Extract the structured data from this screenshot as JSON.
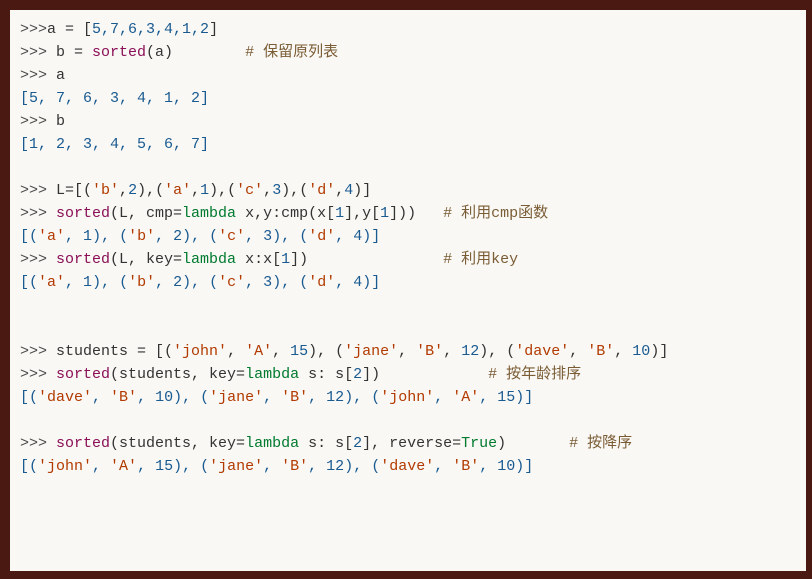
{
  "lines": {
    "l1": {
      "prompt": ">>>",
      "code1": "a = [",
      "nums": "5,7,6,3,4,1,2",
      "code2": "]"
    },
    "l2": {
      "prompt": ">>> ",
      "code1": "b = ",
      "fn": "sorted",
      "code2": "(a)        ",
      "comment": "# 保留原列表"
    },
    "l3": {
      "prompt": ">>> ",
      "code1": "a"
    },
    "l4": {
      "out": "[5, 7, 6, 3, 4, 1, 2]"
    },
    "l5": {
      "prompt": ">>> ",
      "code1": "b"
    },
    "l6": {
      "out": "[1, 2, 3, 4, 5, 6, 7]"
    },
    "l7": {
      "prompt": ">>> ",
      "code1": "L=[(",
      "s1": "'b'",
      "code2": ",",
      "n1": "2",
      "code3": "),(",
      "s2": "'a'",
      "code4": ",",
      "n2": "1",
      "code5": "),(",
      "s3": "'c'",
      "code6": ",",
      "n3": "3",
      "code7": "),(",
      "s4": "'d'",
      "code8": ",",
      "n4": "4",
      "code9": ")]"
    },
    "l8": {
      "prompt": ">>> ",
      "fn": "sorted",
      "code1": "(L, cmp=",
      "kw": "lambda",
      "code2": " x,y:cmp(x[",
      "n1": "1",
      "code3": "],y[",
      "n2": "1",
      "code4": "]))   ",
      "comment": "# 利用cmp函数"
    },
    "l9": {
      "out1": "[(",
      "s1": "'a'",
      "out2": ", ",
      "n1": "1",
      "out3": "), (",
      "s2": "'b'",
      "out4": ", ",
      "n2": "2",
      "out5": "), (",
      "s3": "'c'",
      "out6": ", ",
      "n3": "3",
      "out7": "), (",
      "s4": "'d'",
      "out8": ", ",
      "n4": "4",
      "out9": ")]"
    },
    "l10": {
      "prompt": ">>> ",
      "fn": "sorted",
      "code1": "(L, key=",
      "kw": "lambda",
      "code2": " x:x[",
      "n1": "1",
      "code3": "])               ",
      "comment": "# 利用key"
    },
    "l11": {
      "out1": "[(",
      "s1": "'a'",
      "out2": ", ",
      "n1": "1",
      "out3": "), (",
      "s2": "'b'",
      "out4": ", ",
      "n2": "2",
      "out5": "), (",
      "s3": "'c'",
      "out6": ", ",
      "n3": "3",
      "out7": "), (",
      "s4": "'d'",
      "out8": ", ",
      "n4": "4",
      "out9": ")]"
    },
    "l12": {
      "prompt": ">>> ",
      "code1": "students = [(",
      "s1": "'john'",
      "code2": ", ",
      "s2": "'A'",
      "code3": ", ",
      "n1": "15",
      "code4": "), (",
      "s3": "'jane'",
      "code5": ", ",
      "s4": "'B'",
      "code6": ", ",
      "n2": "12",
      "code7": "), (",
      "s5": "'dave'",
      "code8": ", ",
      "s6": "'B'",
      "code9": ", ",
      "n3": "10",
      "code10": ")]"
    },
    "l13": {
      "prompt": ">>> ",
      "fn": "sorted",
      "code1": "(students, key=",
      "kw": "lambda",
      "code2": " s: s[",
      "n1": "2",
      "code3": "])            ",
      "comment": "# 按年龄排序"
    },
    "l14": {
      "out1": "[(",
      "s1": "'dave'",
      "out2": ", ",
      "s2": "'B'",
      "out3": ", ",
      "n1": "10",
      "out4": "), (",
      "s3": "'jane'",
      "out5": ", ",
      "s4": "'B'",
      "out6": ", ",
      "n2": "12",
      "out7": "), (",
      "s5": "'john'",
      "out8": ", ",
      "s6": "'A'",
      "out9": ", ",
      "n3": "15",
      "out10": ")]"
    },
    "l15": {
      "prompt": ">>> ",
      "fn": "sorted",
      "code1": "(students, key=",
      "kw": "lambda",
      "code2": " s: s[",
      "n1": "2",
      "code3": "], reverse=",
      "kw2": "True",
      "code4": ")       ",
      "comment": "# 按降序"
    },
    "l16": {
      "out1": "[(",
      "s1": "'john'",
      "out2": ", ",
      "s2": "'A'",
      "out3": ", ",
      "n1": "15",
      "out4": "), (",
      "s3": "'jane'",
      "out5": ", ",
      "s4": "'B'",
      "out6": ", ",
      "n2": "12",
      "out7": "), (",
      "s5": "'dave'",
      "out8": ", ",
      "s6": "'B'",
      "out9": ", ",
      "n3": "10",
      "out10": ")]"
    }
  }
}
